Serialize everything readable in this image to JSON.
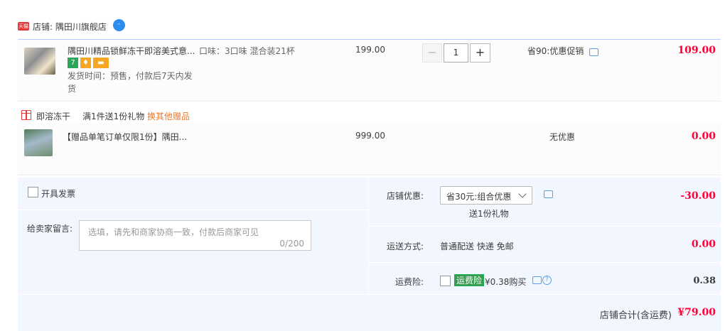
{
  "shop": {
    "badge": "天猫",
    "label": "店铺: 隅田川旗舰店",
    "chat_icon": "wangwang-chat-icon"
  },
  "item": {
    "title": "隅田川精品锁鲜冻干即溶美式意...",
    "sku": "口味：3口味 混合装21杯",
    "ship_time": "发货时间：预售，付款后7天内发货",
    "unit_price": "199.00",
    "qty": "1",
    "minus": "−",
    "plus": "+",
    "promo": "省90:优惠促销",
    "total": "109.00",
    "tag_7": "7"
  },
  "gift_group": {
    "name": "即溶冻干",
    "rule": "满1件送1份礼物",
    "change_link": "换其他赠品"
  },
  "gift_item": {
    "title": "【赠品单笔订单仅限1份】隅田...",
    "unit_price": "999.00",
    "promo": "无优惠",
    "total": "0.00"
  },
  "invoice": {
    "label": "开具发票"
  },
  "message": {
    "label": "给卖家留言:",
    "placeholder": "选填，请先和商家协商一致，付款后商家可见",
    "count": "0/200"
  },
  "coupon": {
    "label": "店铺优惠:",
    "selected": "省30元:组合优惠",
    "gift_note": "送1份礼物",
    "amount": "-30.00"
  },
  "shipping": {
    "label": "运送方式:",
    "value": "普通配送 快递 免邮",
    "amount": "0.00"
  },
  "insurance": {
    "label": "运费险:",
    "badge": "运费险",
    "price": "¥0.38购买",
    "amount": "0.38",
    "help": "?"
  },
  "footer": {
    "label": "店铺合计(含运费)",
    "amount": "¥79.00"
  }
}
